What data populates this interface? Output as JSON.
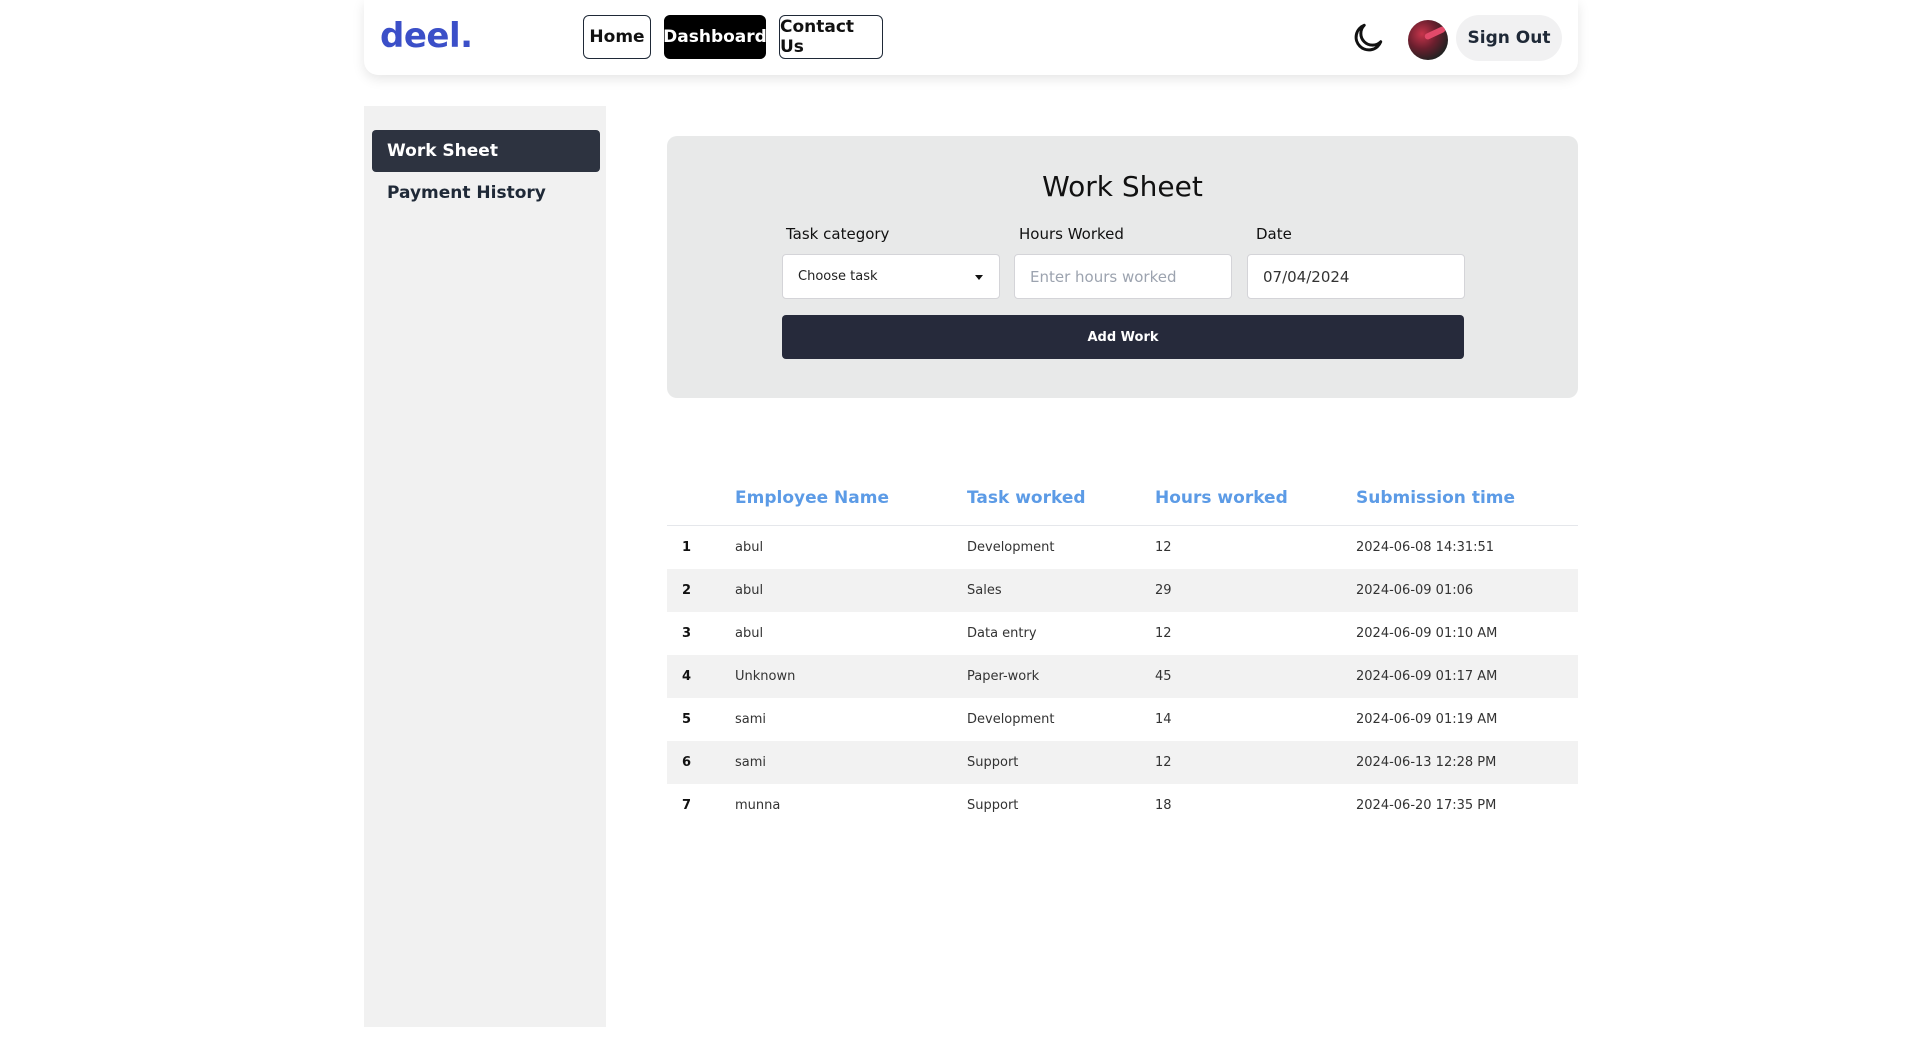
{
  "nav": {
    "logo": "deel.",
    "links": [
      "Home",
      "Dashboard",
      "Contact Us"
    ],
    "active": "Dashboard",
    "sign_out": "Sign Out"
  },
  "sidebar": {
    "items": [
      {
        "label": "Work Sheet",
        "active": true
      },
      {
        "label": "Payment History",
        "active": false
      }
    ]
  },
  "form": {
    "title": "Work Sheet",
    "task_label": "Task category",
    "task_value": "Choose task",
    "hours_label": "Hours Worked",
    "hours_placeholder": "Enter hours worked",
    "date_label": "Date",
    "date_value": "07/04/2024",
    "submit": "Add Work"
  },
  "table": {
    "headers": [
      "Employee Name",
      "Task worked",
      "Hours worked",
      "Submission time"
    ],
    "rows": [
      {
        "n": "1",
        "name": "abul",
        "task": "Development",
        "hours": "12",
        "time": "2024-06-08 14:31:51"
      },
      {
        "n": "2",
        "name": "abul",
        "task": "Sales",
        "hours": "29",
        "time": "2024-06-09 01:06"
      },
      {
        "n": "3",
        "name": "abul",
        "task": "Data entry",
        "hours": "12",
        "time": "2024-06-09 01:10 AM"
      },
      {
        "n": "4",
        "name": "Unknown",
        "task": "Paper-work",
        "hours": "45",
        "time": "2024-06-09 01:17 AM"
      },
      {
        "n": "5",
        "name": "sami",
        "task": "Development",
        "hours": "14",
        "time": "2024-06-09 01:19 AM"
      },
      {
        "n": "6",
        "name": "sami",
        "task": "Support",
        "hours": "12",
        "time": "2024-06-13 12:28 PM"
      },
      {
        "n": "7",
        "name": "munna",
        "task": "Support",
        "hours": "18",
        "time": "2024-06-20 17:35 PM"
      }
    ]
  },
  "icons": {
    "theme_toggle": "moon-icon",
    "profile": "avatar"
  },
  "colors": {
    "brand": "#3b4fc8",
    "header_text": "#5c9be6",
    "button_dark": "#262a3b",
    "sidebar_active": "#2d3340"
  }
}
